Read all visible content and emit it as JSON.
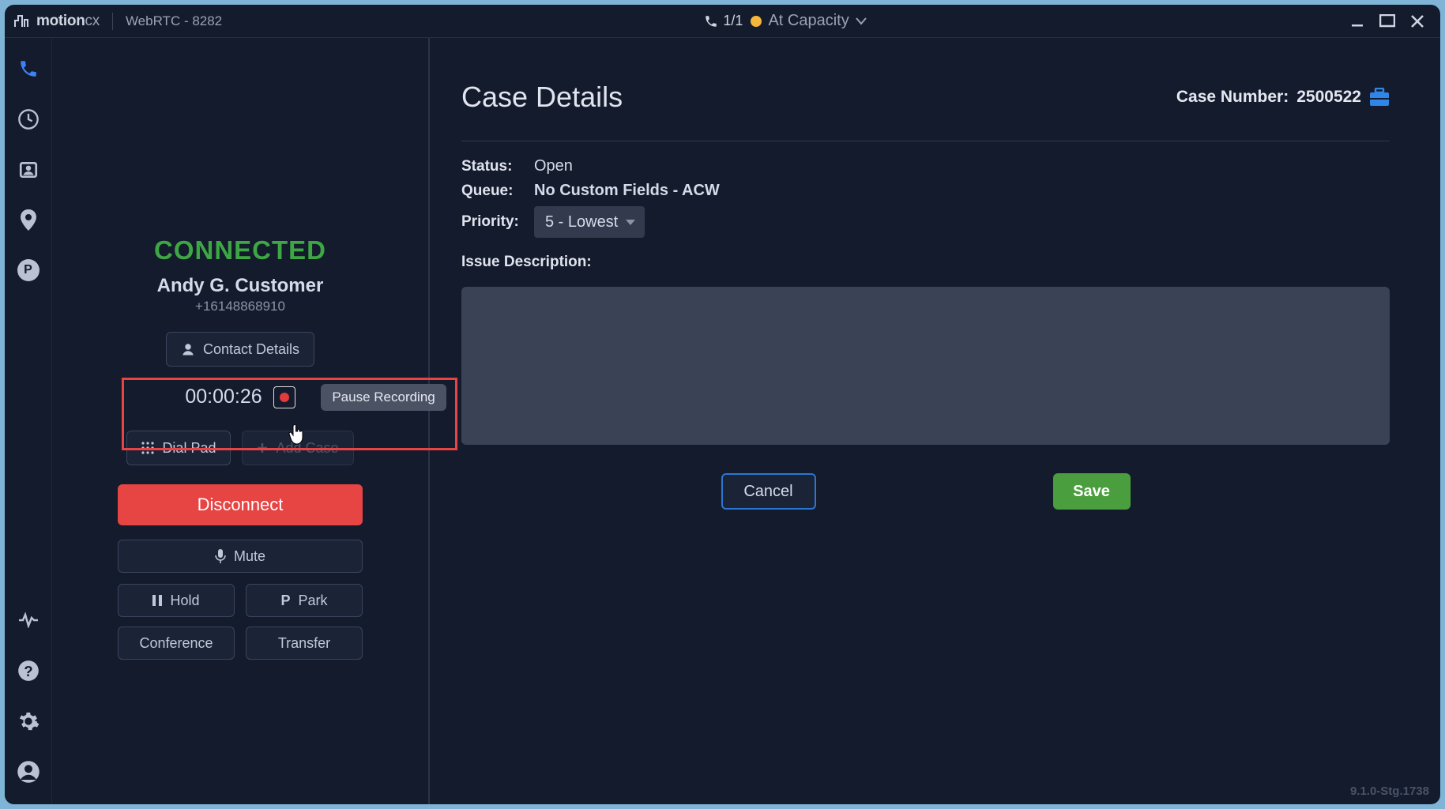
{
  "app": {
    "brand_main": "motion",
    "brand_suffix": "cx",
    "connection_label": "WebRTC - 8282",
    "call_counter": "1/1",
    "status_text": "At Capacity",
    "status_color": "#f5b73a",
    "version": "9.1.0-Stg.1738"
  },
  "sidebar": {
    "icons": {
      "phone": "phone-icon",
      "clock": "clock-icon",
      "contact": "contact-card-icon",
      "location": "location-pin-icon",
      "park": "P",
      "monitor": "monitor-icon",
      "help": "help-icon",
      "settings": "gear-icon",
      "account": "account-icon"
    }
  },
  "call": {
    "status": "CONNECTED",
    "caller_name": "Andy G. Customer",
    "caller_phone": "+16148868910",
    "contact_details_label": "Contact Details",
    "timer": "00:00:26",
    "tooltip": "Pause Recording",
    "dialpad_label": "Dial Pad",
    "addcase_label": "Add Case",
    "disconnect_label": "Disconnect",
    "mute_label": "Mute",
    "hold_label": "Hold",
    "park_label": "Park",
    "conference_label": "Conference",
    "transfer_label": "Transfer"
  },
  "case": {
    "title": "Case Details",
    "case_number_label": "Case Number:",
    "case_number": "2500522",
    "status_label": "Status:",
    "status_value": "Open",
    "queue_label": "Queue:",
    "queue_value": "No Custom Fields - ACW",
    "priority_label": "Priority:",
    "priority_value": "5 - Lowest",
    "description_label": "Issue Description:",
    "description_value": "",
    "cancel_label": "Cancel",
    "save_label": "Save"
  }
}
